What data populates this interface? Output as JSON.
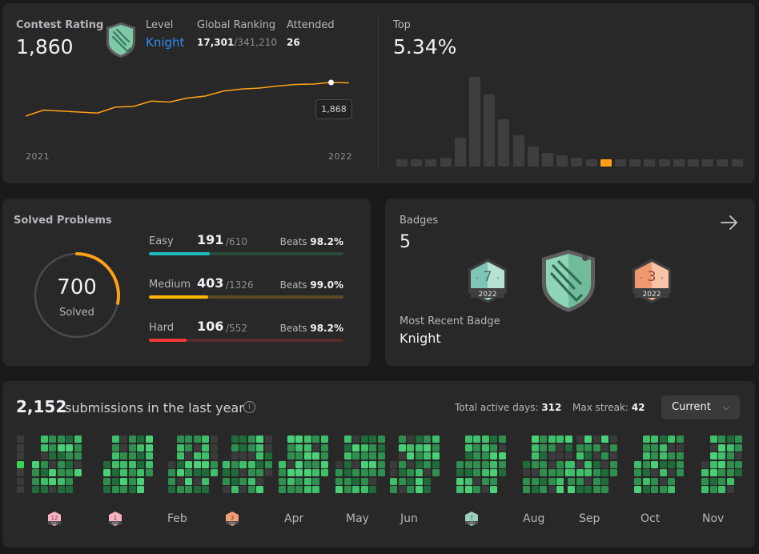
{
  "contest": {
    "rating_label": "Contest Rating",
    "rating": "1,860",
    "level_label": "Level",
    "level": "Knight",
    "ranking_label": "Global Ranking",
    "ranking": "17,301",
    "ranking_total": "/341,210",
    "attended_label": "Attended",
    "attended": "26",
    "year_start": "2021",
    "year_end": "2022",
    "tooltip": "1,868",
    "line_series": [
      1700,
      1730,
      1725,
      1720,
      1715,
      1745,
      1748,
      1775,
      1770,
      1790,
      1800,
      1825,
      1835,
      1840,
      1850,
      1858,
      1860,
      1868,
      1866
    ],
    "top_label": "Top",
    "top_value": "5.34%",
    "histogram": [
      3,
      3,
      3,
      4,
      13,
      40,
      32,
      21,
      14,
      9,
      6,
      5,
      4,
      3,
      3,
      3,
      2,
      2,
      2,
      2,
      2,
      2,
      2,
      2
    ],
    "highlight_index": 14,
    "accent": "#ffa116"
  },
  "solved": {
    "title": "Solved Problems",
    "total": "700",
    "total_label": "Solved",
    "ring_fraction": 0.28,
    "rows": [
      {
        "name": "Easy",
        "count": "191",
        "total": "/610",
        "beats_label": "Beats",
        "beats": "98.2%",
        "fraction": 0.313,
        "color": "#1cbaba",
        "track": "#2a4a39"
      },
      {
        "name": "Medium",
        "count": "403",
        "total": "/1326",
        "beats_label": "Beats",
        "beats": "99.0%",
        "fraction": 0.304,
        "color": "#ffb700",
        "track": "#5a4a25"
      },
      {
        "name": "Hard",
        "count": "106",
        "total": "/552",
        "beats_label": "Beats",
        "beats": "98.2%",
        "fraction": 0.192,
        "color": "#f63737",
        "track": "#5a2a2a"
      }
    ]
  },
  "badges": {
    "title": "Badges",
    "count": "5",
    "recent_label": "Most Recent Badge",
    "recent": "Knight",
    "items": [
      {
        "icon": "annual-badge-7-icon",
        "num": "7",
        "year": "2022"
      },
      {
        "icon": "knight-badge-icon"
      },
      {
        "icon": "annual-badge-3-icon",
        "num": "3",
        "year": "2022"
      }
    ]
  },
  "submissions": {
    "count": "2,152",
    "text": "submissions in the last year",
    "active_label": "Total active days:",
    "active": "312",
    "streak_label": "Max streak:",
    "streak": "42",
    "selector": "Current",
    "months": [
      "Feb",
      "Apr",
      "May",
      "Jun",
      "Aug",
      "Sep",
      "Oct",
      "Nov"
    ],
    "mini_badges": [
      {
        "num": "12",
        "year": "2021"
      },
      {
        "num": "1",
        "year": "2022"
      },
      {
        "num": "3",
        "year": "2022"
      },
      {
        "num": "7",
        "year": "2022"
      }
    ]
  }
}
